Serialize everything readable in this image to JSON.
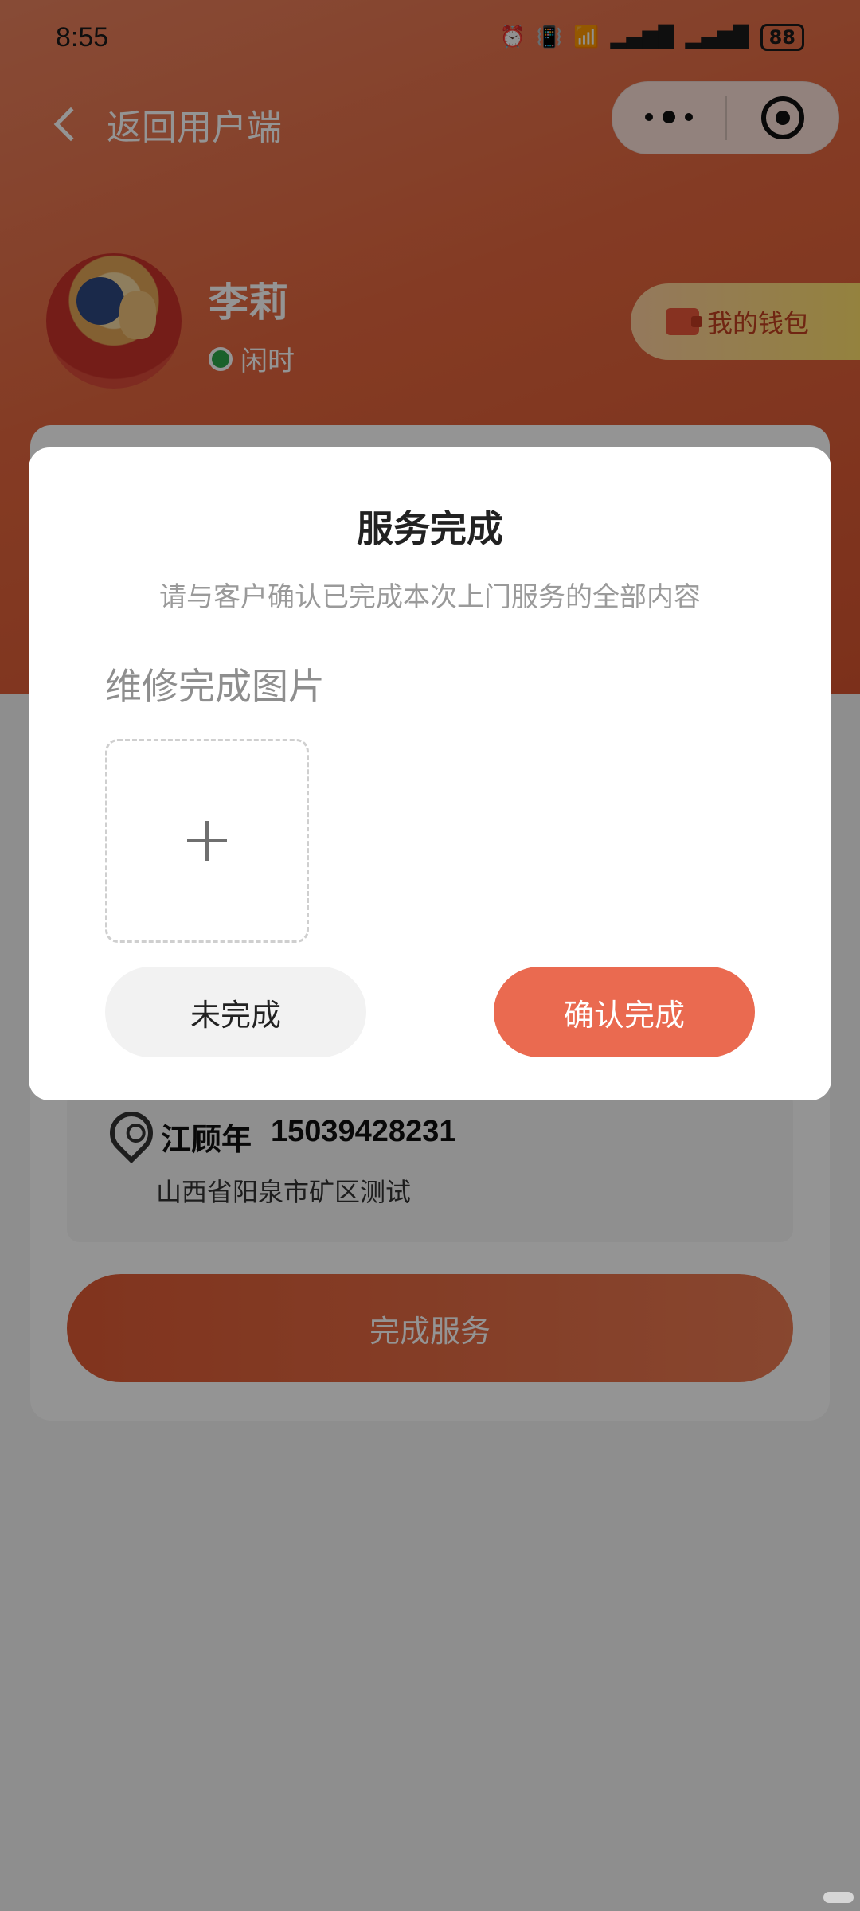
{
  "status_bar": {
    "time": "8:55",
    "icons": [
      "alarm-icon",
      "vibrate-icon",
      "wifi-icon",
      "signal-5g-icon",
      "signal-5g-icon"
    ],
    "battery": "88"
  },
  "nav": {
    "back_label": "返回用户端"
  },
  "profile": {
    "name": "李莉",
    "status": "闲时"
  },
  "wallet": {
    "label": "我的钱包"
  },
  "address": {
    "name": "江顾年",
    "phone": "15039428231",
    "line": "山西省阳泉市矿区测试"
  },
  "primary_action": {
    "label": "完成服务"
  },
  "modal": {
    "title": "服务完成",
    "subtitle": "请与客户确认已完成本次上门服务的全部内容",
    "photo_label": "维修完成图片",
    "not_done_label": "未完成",
    "confirm_label": "确认完成"
  },
  "colors": {
    "accent": "#ea6a50",
    "hero_gradient_start": "#e9825e",
    "hero_gradient_end": "#d6542f",
    "online_green": "#2ea84a"
  }
}
